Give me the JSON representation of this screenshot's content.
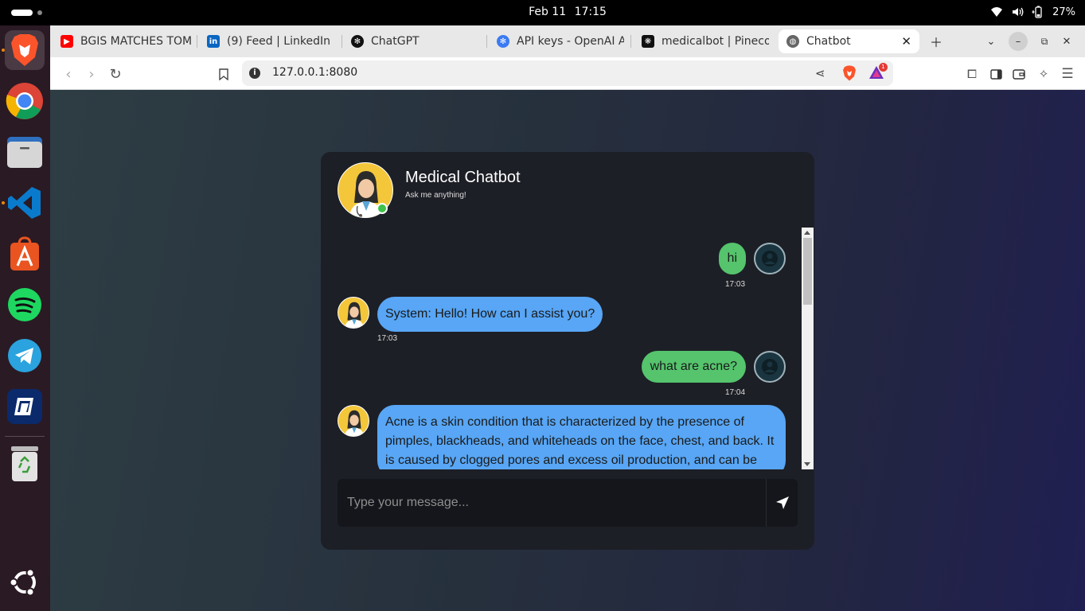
{
  "system": {
    "date": "Feb 11",
    "time": "17:15",
    "battery": "27%"
  },
  "dock": {
    "apps": [
      "Brave Browser",
      "Google Chrome",
      "Files",
      "Visual Studio Code",
      "App Center",
      "Spotify",
      "Telegram",
      "Remote Desktop",
      "Trash",
      "Show Apps"
    ]
  },
  "browser": {
    "tabs": [
      {
        "title": "BGIS MATCHES TOM",
        "icon": "youtube-icon"
      },
      {
        "title": "(9) Feed | LinkedIn",
        "icon": "linkedin-icon"
      },
      {
        "title": "ChatGPT",
        "icon": "chatgpt-icon"
      },
      {
        "title": "API keys - OpenAI A",
        "icon": "openai-icon"
      },
      {
        "title": "medicalbot | Pineco",
        "icon": "pinecone-icon"
      },
      {
        "title": "Chatbot",
        "icon": "globe-icon",
        "active": true
      }
    ],
    "url": "127.0.0.1:8080",
    "rewards_badge": "1"
  },
  "chat": {
    "title": "Medical Chatbot",
    "subtitle": "Ask me anything!",
    "messages": [
      {
        "from": "user",
        "text": "hi",
        "time": "17:03"
      },
      {
        "from": "bot",
        "text": "System: Hello! How can I assist you?",
        "time": "17:03"
      },
      {
        "from": "user",
        "text": "what are acne?",
        "time": "17:04"
      },
      {
        "from": "bot",
        "text": "Acne is a skin condition that is characterized by the presence of pimples, blackheads, and whiteheads on the face, chest, and back. It is caused by clogged pores and excess oil production, and can be"
      }
    ],
    "input_placeholder": "Type your message...",
    "colors": {
      "user_bubble": "#55c46d",
      "bot_bubble": "#58a6f5",
      "card_bg": "#1d1f26"
    }
  }
}
